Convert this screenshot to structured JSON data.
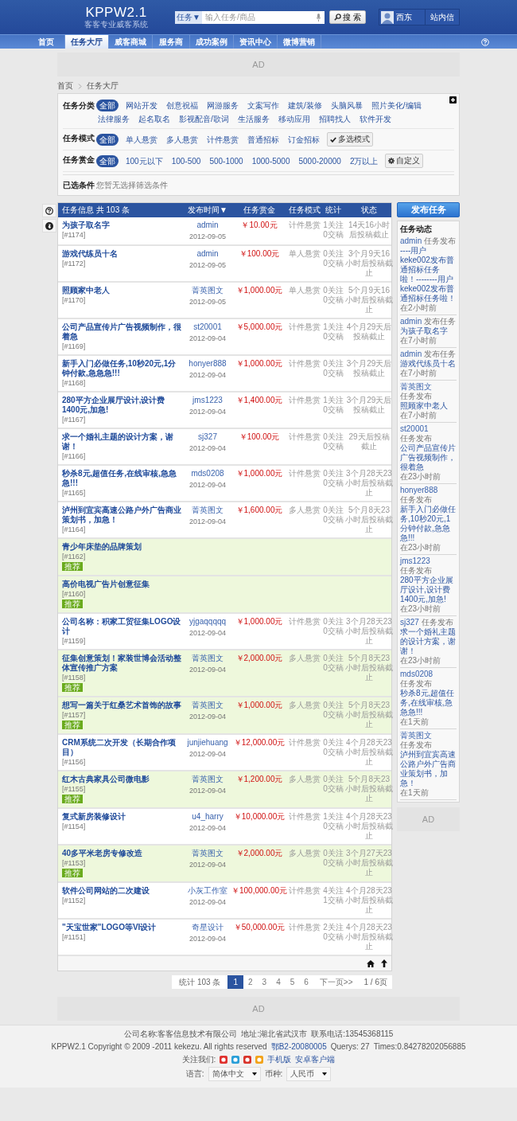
{
  "header": {
    "logo": "KPPW2.1",
    "tagline": "客客专业威客系统",
    "search": {
      "scope": "任务▼",
      "placeholder": "输入任务/商品",
      "button": "搜 索"
    },
    "user": {
      "name": "西东",
      "messages": "站内信"
    }
  },
  "nav": [
    {
      "label": "首页",
      "selected": false
    },
    {
      "label": "任务大厅",
      "selected": true
    },
    {
      "label": "威客商城",
      "selected": false
    },
    {
      "label": "服务商",
      "selected": false
    },
    {
      "label": "成功案例",
      "selected": false
    },
    {
      "label": "资讯中心",
      "selected": false
    },
    {
      "label": "微博营销",
      "selected": false
    }
  ],
  "top_ad": "AD",
  "breadcrumb": [
    "首页",
    "任务大厅"
  ],
  "filters": [
    {
      "label": "任务分类",
      "options": [
        {
          "label": "全部",
          "selected": true
        },
        {
          "label": "网站开发",
          "selected": false
        },
        {
          "label": "创意祝福",
          "selected": false
        },
        {
          "label": "网游服务",
          "selected": false
        },
        {
          "label": "文案写作",
          "selected": false
        },
        {
          "label": "建筑/装修",
          "selected": false
        },
        {
          "label": "头脑风暴",
          "selected": false
        },
        {
          "label": "照片美化/编辑",
          "selected": false
        },
        {
          "label": "法律服务",
          "selected": false
        },
        {
          "label": "起名取名",
          "selected": false
        },
        {
          "label": "影视配音/歌词",
          "selected": false
        },
        {
          "label": "生活服务",
          "selected": false
        },
        {
          "label": "移动应用",
          "selected": false
        },
        {
          "label": "招聘找人",
          "selected": false
        },
        {
          "label": "软件开发",
          "selected": false
        }
      ]
    },
    {
      "label": "任务模式",
      "options": [
        {
          "label": "全部",
          "selected": true
        },
        {
          "label": "单人悬赏",
          "selected": false
        },
        {
          "label": "多人悬赏",
          "selected": false
        },
        {
          "label": "计件悬赏",
          "selected": false
        },
        {
          "label": "普通招标",
          "selected": false
        },
        {
          "label": "订金招标",
          "selected": false
        }
      ],
      "extra": {
        "kind": "check",
        "label": "多选模式"
      }
    },
    {
      "label": "任务赏金",
      "options": [
        {
          "label": "全部",
          "selected": true
        },
        {
          "label": "100元以下",
          "selected": false
        },
        {
          "label": "100-500",
          "selected": false
        },
        {
          "label": "500-1000",
          "selected": false
        },
        {
          "label": "1000-5000",
          "selected": false
        },
        {
          "label": "5000-20000",
          "selected": false
        },
        {
          "label": "2万以上",
          "selected": false
        }
      ],
      "extra": {
        "kind": "gear",
        "label": "自定义"
      }
    }
  ],
  "selected_conditions": {
    "label": "已选条件",
    "text": "您暂无选择筛选条件"
  },
  "table": {
    "columns": [
      "任务信息 共 103 条",
      "发布时间▼",
      "任务赏金",
      "任务模式",
      "统计",
      "状态"
    ],
    "rows": [
      {
        "title": "为孩子取名字",
        "id": "[#1174]",
        "author": "admin",
        "date": "2012-09-05",
        "prize": "￥10.00元",
        "mode": "计件悬赏",
        "follows": "1关注",
        "submissions": "0交稿",
        "status": "14天16小时后投稿截止",
        "recommended": false
      },
      {
        "title": "游戏代练员十名",
        "id": "[#1172]",
        "author": "admin",
        "date": "2012-09-05",
        "prize": "￥100.00元",
        "mode": "单人悬赏",
        "follows": "0关注",
        "submissions": "0交稿",
        "status": "3个月9天16小时后投稿截止",
        "recommended": false
      },
      {
        "title": "照顾家中老人",
        "id": "[#1170]",
        "author": "菁英图文",
        "date": "2012-09-05",
        "prize": "￥1,000.00元",
        "mode": "单人悬赏",
        "follows": "0关注",
        "submissions": "0交稿",
        "status": "5个月9天16小时后投稿截止",
        "recommended": false
      },
      {
        "title": "公司产品宣传片广告视频制作，很着急",
        "id": "[#1169]",
        "author": "st20001",
        "date": "2012-09-04",
        "prize": "￥5,000.00元",
        "mode": "计件悬赏",
        "follows": "1关注",
        "submissions": "0交稿",
        "status": "4个月29天后投稿截止",
        "recommended": false
      },
      {
        "title": "新手入门必做任务,10秒20元,1分钟付款,急急急!!!",
        "id": "[#1168]",
        "author": "honyer888",
        "date": "2012-09-04",
        "prize": "￥1,000.00元",
        "mode": "计件悬赏",
        "follows": "0关注",
        "submissions": "0交稿",
        "status": "3个月29天后投稿截止",
        "recommended": false
      },
      {
        "title": "280平方企业展厅设计,设计费1400元,加急!",
        "id": "[#1167]",
        "author": "jms1223",
        "date": "2012-09-04",
        "prize": "￥1,400.00元",
        "mode": "计件悬赏",
        "follows": "1关注",
        "submissions": "0交稿",
        "status": "3个月29天后投稿截止",
        "recommended": false
      },
      {
        "title": "求一个婚礼主题的设计方案，谢谢！",
        "id": "[#1166]",
        "author": "sj327",
        "date": "2012-09-04",
        "prize": "￥100.00元",
        "mode": "计件悬赏",
        "follows": "0关注",
        "submissions": "0交稿",
        "status": "29天后投稿截止",
        "recommended": false
      },
      {
        "title": "秒杀8元,超值任务,在线审核,急急急!!!",
        "id": "[#1165]",
        "author": "mds0208",
        "date": "2012-09-04",
        "prize": "￥1,000.00元",
        "mode": "计件悬赏",
        "follows": "0关注",
        "submissions": "0交稿",
        "status": "3个月28天23小时后投稿截止",
        "recommended": false
      },
      {
        "title": "泸州到宜宾高速公路户外广告商业策划书，加急！",
        "id": "[#1164]",
        "author": "菁英图文",
        "date": "2012-09-04",
        "prize": "￥1,600.00元",
        "mode": "多人悬赏",
        "follows": "0关注",
        "submissions": "0交稿",
        "status": "5个月8天23小时后投稿截止",
        "recommended": false
      },
      {
        "title": "青少年床垫的品牌策划",
        "id": "[#1162]",
        "tag": "推荐",
        "recommended": true
      },
      {
        "title": "高价电视广告片创意征集",
        "id": "[#1160]",
        "tag": "推荐",
        "recommended": true
      },
      {
        "title": "公司名称：积家工贸征集LOGO设计",
        "id": "[#1159]",
        "author": "yjgaqqqqq",
        "date": "2012-09-04",
        "prize": "￥1,000.00元",
        "mode": "计件悬赏",
        "follows": "0关注",
        "submissions": "0交稿",
        "status": "3个月28天23小时后投稿截止",
        "recommended": false
      },
      {
        "title": "征集创意策划！家装世博会活动整体宣传推广方案",
        "id": "[#1158]",
        "tag": "推荐",
        "author": "菁英图文",
        "date": "2012-09-04",
        "prize": "￥2,000.00元",
        "mode": "多人悬赏",
        "follows": "0关注",
        "submissions": "0交稿",
        "status": "5个月8天23小时后投稿截止",
        "recommended": true
      },
      {
        "title": "想写一篇关于红桑艺术首饰的故事",
        "id": "[#1157]",
        "tag": "推荐",
        "author": "菁英图文",
        "date": "2012-09-04",
        "prize": "￥1,000.00元",
        "mode": "多人悬赏",
        "follows": "0关注",
        "submissions": "0交稿",
        "status": "5个月8天23小时后投稿截止",
        "recommended": true
      },
      {
        "title": "CRM系统二次开发（长期合作项目）",
        "id": "[#1156]",
        "author": "junjiehuang",
        "date": "2012-09-04",
        "prize": "￥12,000.00元",
        "mode": "计件悬赏",
        "follows": "0关注",
        "submissions": "0交稿",
        "status": "4个月28天23小时后投稿截止",
        "recommended": false
      },
      {
        "title": "红木古典家具公司微电影",
        "id": "[#1155]",
        "tag": "推荐",
        "author": "菁英图文",
        "date": "2012-09-04",
        "prize": "￥1,200.00元",
        "mode": "多人悬赏",
        "follows": "0关注",
        "submissions": "0交稿",
        "status": "5个月8天23小时后投稿截止",
        "recommended": true
      },
      {
        "title": "复式新房装修设计",
        "id": "[#1154]",
        "author": "u4_harry",
        "date": "2012-09-04",
        "prize": "￥10,000.00元",
        "mode": "计件悬赏",
        "follows": "1关注",
        "submissions": "0交稿",
        "status": "4个月28天23小时后投稿截止",
        "recommended": false
      },
      {
        "title": "40多平米老房专修改造",
        "id": "[#1153]",
        "tag": "推荐",
        "author": "菁英图文",
        "date": "2012-09-04",
        "prize": "￥2,000.00元",
        "mode": "多人悬赏",
        "follows": "0关注",
        "submissions": "0交稿",
        "status": "3个月27天23小时后投稿截止",
        "recommended": true
      },
      {
        "title": "软件公司网站的二次建设",
        "id": "[#1152]",
        "author": "小灰工作室",
        "date": "2012-09-04",
        "prize": "￥100,000.00元",
        "mode": "计件悬赏",
        "follows": "4关注",
        "submissions": "1交稿",
        "status": "4个月28天23小时后投稿截止",
        "recommended": false
      },
      {
        "title": "\"天宝世家\"LOGO等VI设计",
        "id": "[#1151]",
        "author": "奇星设计",
        "date": "2012-09-04",
        "prize": "￥50,000.00元",
        "mode": "计件悬赏",
        "follows": "2关注",
        "submissions": "0交稿",
        "status": "4个月28天23小时后投稿截止",
        "recommended": false
      }
    ]
  },
  "pagination": {
    "summary": "统计 103 条",
    "pages": [
      {
        "label": "1",
        "selected": true
      },
      {
        "label": "2",
        "selected": false
      },
      {
        "label": "3",
        "selected": false
      },
      {
        "label": "4",
        "selected": false
      },
      {
        "label": "5",
        "selected": false
      },
      {
        "label": "6",
        "selected": false
      }
    ],
    "next": "下一页>>",
    "position": "1 / 6页"
  },
  "sidebar": {
    "publish_button": "发布任务",
    "feed_title": "任务动态",
    "feed": [
      {
        "user": "admin",
        "action": "任务发布",
        "title": "----用户keke002发布普通招标任务啦！--------用户keke002发布普通招标任务啦！",
        "time": "在2小时前"
      },
      {
        "user": "admin",
        "action": "发布任务",
        "title": "为孩子取名字",
        "time": "在7小时前"
      },
      {
        "user": "admin",
        "action": "发布任务",
        "title": "游戏代练员十名",
        "time": "在7小时前"
      },
      {
        "user": "菁英图文",
        "action": "任务发布",
        "title": "照顾家中老人",
        "time": "在7小时前"
      },
      {
        "user": "st20001",
        "action": "任务发布",
        "title": "公司产品宣传片广告视频制作，很着急",
        "time": "在23小时前"
      },
      {
        "user": "honyer888",
        "action": "任务发布",
        "title": "新手入门必做任务,10秒20元,1分钟付款,急急急!!!",
        "time": "在23小时前"
      },
      {
        "user": "jms1223",
        "action": "任务发布",
        "title": "280平方企业展厅设计,设计费1400元,加急!",
        "time": "在23小时前"
      },
      {
        "user": "sj327",
        "action": "任务发布",
        "title": "求一个婚礼主题的设计方案，谢谢！",
        "time": "在23小时前"
      },
      {
        "user": "mds0208",
        "action": "任务发布",
        "title": "秒杀8元,超值任务,在线审核,急急急!!!",
        "time": "在1天前"
      },
      {
        "user": "菁英图文",
        "action": "任务发布",
        "title": "泸州到宜宾高速公路户外广告商业策划书，加急！",
        "time": "在1天前"
      }
    ],
    "ad": "AD"
  },
  "bottom_ad": "AD",
  "footer": {
    "company": [
      "公司名称:客客信息技术有限公司",
      "地址:湖北省武汉市",
      "联系电话:13545368115"
    ],
    "copyright": "KPPW2.1 Copyright © 2009 -2011 kekezu. All rights reserved",
    "icp": "鄂B2-20080005",
    "querys": "Querys: 27",
    "times": "Times:0.84278202056885",
    "follow_label": "关注我们:",
    "apps": [
      "手机版",
      "安卓客户端"
    ],
    "language_label": "语言:",
    "language": "简体中文",
    "currency_label": "币种:",
    "currency": "人民币"
  }
}
